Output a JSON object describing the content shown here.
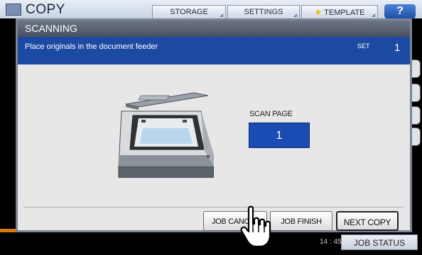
{
  "header": {
    "title": "COPY",
    "tabs": [
      {
        "label": "STORAGE"
      },
      {
        "label": "SETTINGS"
      },
      {
        "label": "TEMPLATE"
      }
    ],
    "help_label": "?"
  },
  "dialog": {
    "title": "SCANNING",
    "message": "Place originals in the document feeder",
    "set_label": "SET",
    "set_value": "1",
    "scan_page_label": "SCAN PAGE",
    "scan_page_value": "1",
    "buttons": {
      "job_cancel": "JOB CANCEL",
      "job_finish": "JOB FINISH",
      "next_copy": "NEXT COPY"
    }
  },
  "footer": {
    "time": "14 : 45",
    "job_status": "JOB STATUS"
  },
  "colors": {
    "accent_blue": "#1c4aa3",
    "scan_box_blue": "#1a4cb3",
    "title_bar_gray": "#5a6273",
    "orange_indicator": "#d77a10"
  },
  "icons": {
    "app": "copier-icon",
    "template": "star-icon",
    "cursor": "hand-pointer-icon",
    "scanner": "scanner-illustration"
  }
}
